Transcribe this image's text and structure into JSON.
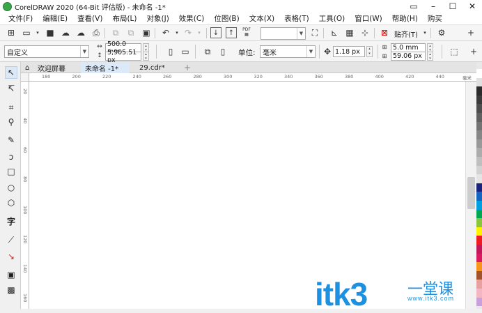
{
  "window": {
    "title": "CorelDRAW 2020 (64-Bit 评估版) - 未命名 -1*",
    "controls": [
      "▭",
      "–",
      "☐",
      "✕"
    ]
  },
  "menu": [
    "文件(F)",
    "编辑(E)",
    "查看(V)",
    "布局(L)",
    "对象(J)",
    "效果(C)",
    "位图(B)",
    "文本(X)",
    "表格(T)",
    "工具(O)",
    "窗口(W)",
    "帮助(H)",
    "购买"
  ],
  "toolbar1": {
    "pdf_label": "PDF",
    "zoom_value": "",
    "snap_label": "贴齐(T)"
  },
  "property_bar": {
    "page_preset": "自定义",
    "width": "500.0 mm",
    "height": "5,905.51 px",
    "units_label": "单位:",
    "units_value": "毫米",
    "nudge": "1.18 px",
    "dup_x": "5.0 mm",
    "dup_y": "59.06 px"
  },
  "tabs": {
    "home_icon": "home-icon",
    "welcome": "欢迎屏幕",
    "active": "未命名 -1*",
    "other": "29.cdr*",
    "add": "+"
  },
  "ruler": {
    "top_labels": [
      "180",
      "200",
      "220",
      "240",
      "260",
      "280",
      "300",
      "320",
      "340",
      "360",
      "380",
      "400",
      "420",
      "440"
    ],
    "units": "毫米",
    "left_labels": [
      "20",
      "40",
      "60",
      "80",
      "100",
      "120",
      "140",
      "160"
    ]
  },
  "toolbox": [
    "pick-tool-icon",
    "shape-tool-icon",
    "crop-tool-icon",
    "zoom-tool-icon",
    "freehand-tool-icon",
    "artistic-media-icon",
    "rectangle-tool-icon",
    "ellipse-tool-icon",
    "polygon-tool-icon",
    "text-tool-icon",
    "parallel-dimension-icon",
    "connector-tool-icon",
    "drop-shadow-icon",
    "transparency-icon"
  ],
  "palette_colors": [
    "#ffffff",
    "#e0e0e0",
    "#2b2b2b",
    "#3a3a3a",
    "#4d4d4d",
    "#606060",
    "#737373",
    "#868686",
    "#999999",
    "#acacac",
    "#bfbfbf",
    "#d2d2d2",
    "#e5e5e5",
    "#1a237e",
    "#1565c0",
    "#00a0e0",
    "#00a651",
    "#8bc53f",
    "#fff200",
    "#ed1c24",
    "#c2185b",
    "#d81b60",
    "#f7941d",
    "#a0522d",
    "#e8a0a0",
    "#f4b6c2",
    "#c9a0dc"
  ],
  "watermark": {
    "main": "itk3",
    "cn": "一堂课",
    "sub": "www.itk3.com"
  }
}
